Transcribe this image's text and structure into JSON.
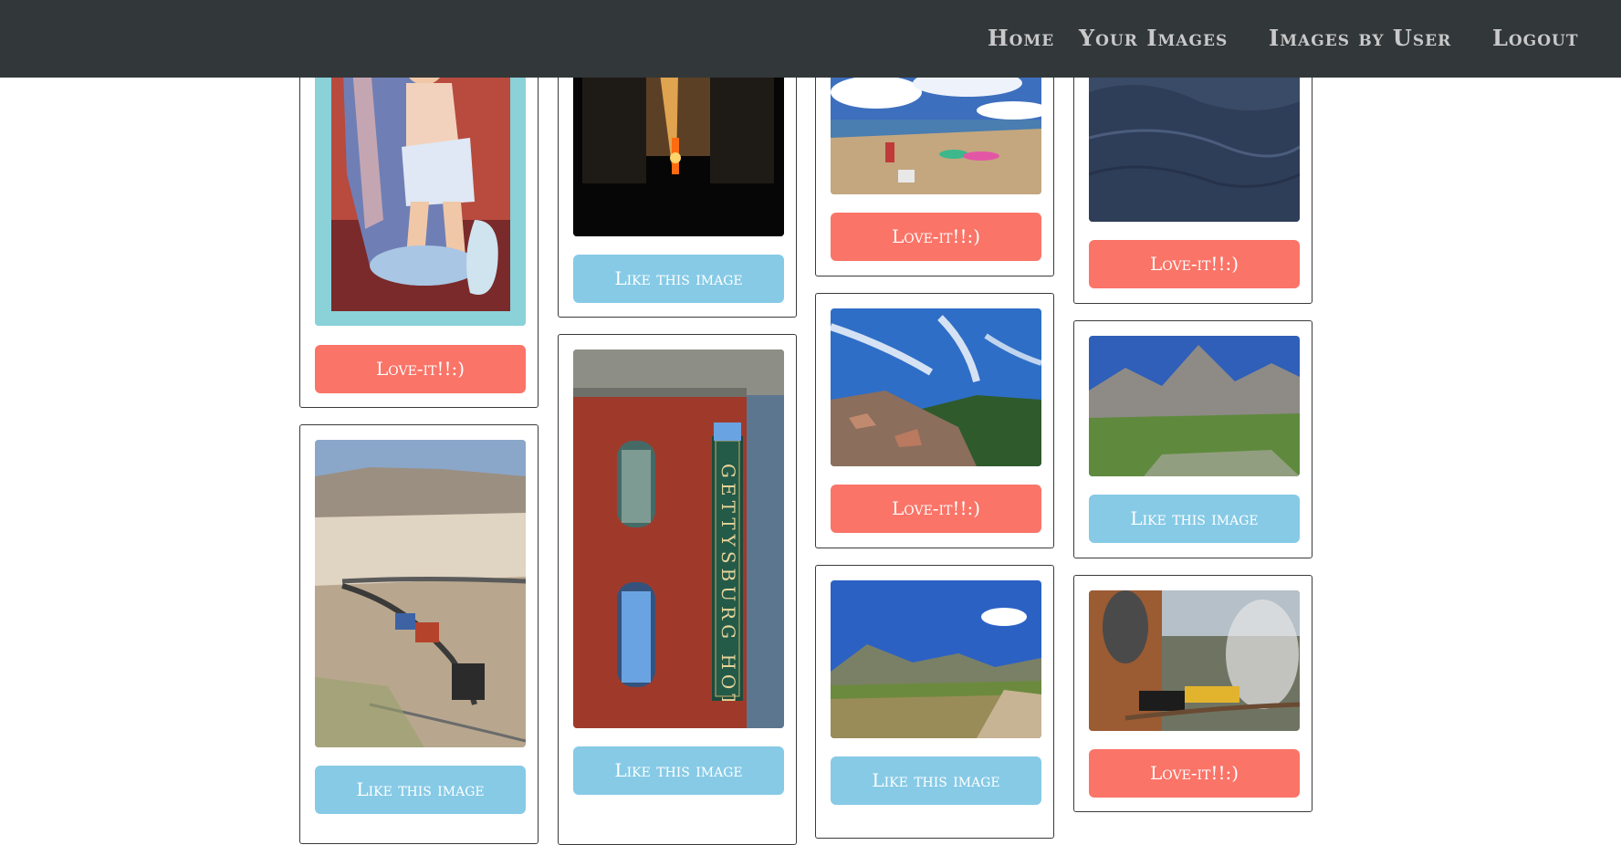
{
  "nav": {
    "home": "Home",
    "your_images": "Your Images",
    "images_by_user": "Images by User",
    "logout": "Logout"
  },
  "buttons": {
    "love": "Love-it!!:)",
    "like": "Like this image"
  },
  "hotel_sign": "GETTYSBURG HOTEL",
  "colors": {
    "nav_bg": "#323739",
    "love_button": "#fa7468",
    "like_button": "#86cae6"
  }
}
